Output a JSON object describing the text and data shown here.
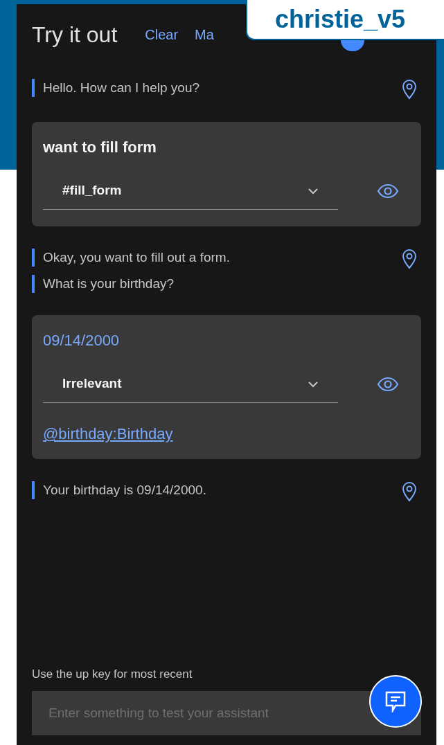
{
  "workspace_tab": {
    "title": "christie_v5"
  },
  "panel": {
    "title": "Try it out",
    "actions": [
      "Clear",
      "Ma"
    ]
  },
  "messages": [
    {
      "kind": "bot",
      "lines": [
        "Hello. How can I help you?"
      ]
    },
    {
      "kind": "user",
      "text": "want to fill form",
      "text_is_link_color": false,
      "intent": "#fill_form"
    },
    {
      "kind": "bot",
      "lines": [
        "Okay, you want to fill out a form.",
        "What is your birthday?"
      ]
    },
    {
      "kind": "user",
      "text": "09/14/2000",
      "text_is_link_color": true,
      "intent": "Irrelevant",
      "entity": "@birthday:Birthday"
    },
    {
      "kind": "bot",
      "lines": [
        "Your birthday is 09/14/2000."
      ]
    }
  ],
  "input": {
    "hint": "Use the up key for most recent",
    "placeholder": "Enter something to test your assistant"
  }
}
